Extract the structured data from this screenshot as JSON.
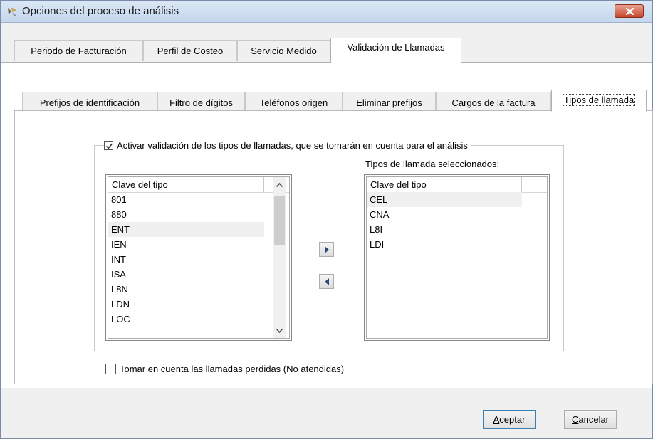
{
  "window": {
    "title": "Opciones del proceso de análisis"
  },
  "main_tabs": [
    {
      "label": "Periodo de Facturación",
      "active": false
    },
    {
      "label": "Perfil de Costeo",
      "active": false
    },
    {
      "label": "Servicio Medido",
      "active": false
    },
    {
      "label": "Validación de Llamadas",
      "active": true
    }
  ],
  "sub_tabs": [
    {
      "label": "Prefijos de identificación",
      "active": false
    },
    {
      "label": "Filtro de dígitos",
      "active": false
    },
    {
      "label": "Teléfonos origen",
      "active": false
    },
    {
      "label": "Eliminar prefijos",
      "active": false
    },
    {
      "label": "Cargos de la factura",
      "active": false
    },
    {
      "label": "Tipos de llamada",
      "active": true
    }
  ],
  "group": {
    "checkbox_label": "Activar validación de los tipos de llamadas, que se tomarán en cuenta para el análisis",
    "checked": true
  },
  "available_list": {
    "column_header": "Clave del tipo",
    "items": [
      "801",
      "880",
      "ENT",
      "IEN",
      "INT",
      "ISA",
      "L8N",
      "LDN",
      "LOC"
    ],
    "highlighted": "ENT"
  },
  "selected_list": {
    "title": "Tipos de llamada seleccionados:",
    "column_header": "Clave del tipo",
    "items": [
      "CEL",
      "CNA",
      "L8I",
      "LDI"
    ],
    "highlighted": "CEL"
  },
  "missed_calls": {
    "label": "Tomar en cuenta las llamadas perdidas (No atendidas)",
    "checked": false
  },
  "buttons": {
    "accept": {
      "mnemonic": "A",
      "rest": "ceptar"
    },
    "cancel": {
      "mnemonic": "C",
      "rest": "ancelar"
    }
  }
}
